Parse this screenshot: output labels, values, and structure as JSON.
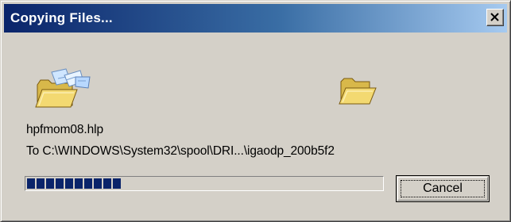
{
  "window": {
    "title": "Copying Files...",
    "close_icon": "close-icon"
  },
  "icons": {
    "source": "flying-papers-folder-icon",
    "destination": "open-folder-icon"
  },
  "file": {
    "name": "hpfmom08.hlp",
    "destination": "To C:\\WINDOWS\\System32\\spool\\DRI...\\igaodp_200b5f2"
  },
  "progress": {
    "fraction": 0.27
  },
  "buttons": {
    "cancel_label": "Cancel"
  },
  "colors": {
    "title_bar_start": "#0a246a",
    "title_bar_end": "#a6caf0",
    "progress_fill": "#0a246a",
    "dialog_face": "#d4d0c8"
  }
}
